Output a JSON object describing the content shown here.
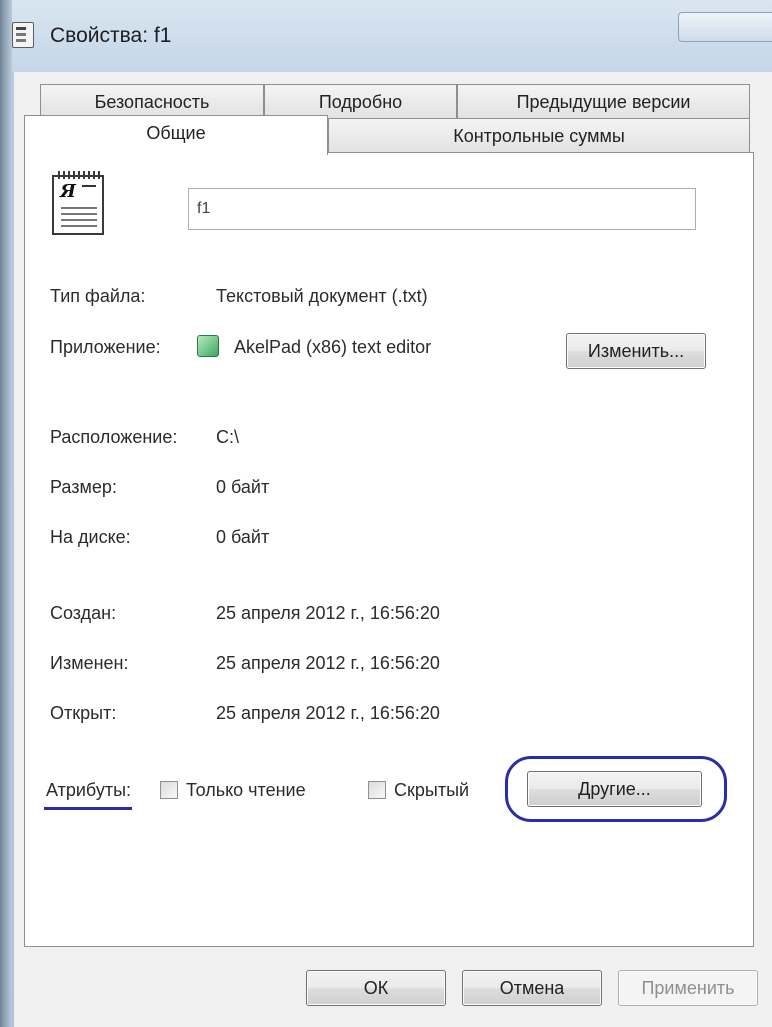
{
  "window": {
    "title": "Свойства: f1"
  },
  "tabs": {
    "row1": [
      "Безопасность",
      "Подробно",
      "Предыдущие версии"
    ],
    "row2": [
      "Общие",
      "Контрольные суммы"
    ],
    "active": "Общие"
  },
  "general": {
    "file_name": "f1",
    "file_type_label": "Тип файла:",
    "file_type_value": "Текстовый документ (.txt)",
    "app_label": "Приложение:",
    "app_value": "AkelPad (x86) text editor",
    "change_button": "Изменить...",
    "location_label": "Расположение:",
    "location_value": "C:\\",
    "size_label": "Размер:",
    "size_value": "0 байт",
    "disk_label": "На диске:",
    "disk_value": "0 байт",
    "created_label": "Создан:",
    "created_value": "25 апреля 2012 г., 16:56:20",
    "modified_label": "Изменен:",
    "modified_value": "25 апреля 2012 г., 16:56:20",
    "opened_label": "Открыт:",
    "opened_value": "25 апреля 2012 г., 16:56:20",
    "attributes_label": "Атрибуты:",
    "readonly_label": "Только чтение",
    "readonly_checked": false,
    "hidden_label": "Скрытый",
    "hidden_checked": false,
    "other_button": "Другие..."
  },
  "footer": {
    "ok": "ОК",
    "cancel": "Отмена",
    "apply": "Применить"
  },
  "colors": {
    "highlight": "#2a2ea6"
  }
}
